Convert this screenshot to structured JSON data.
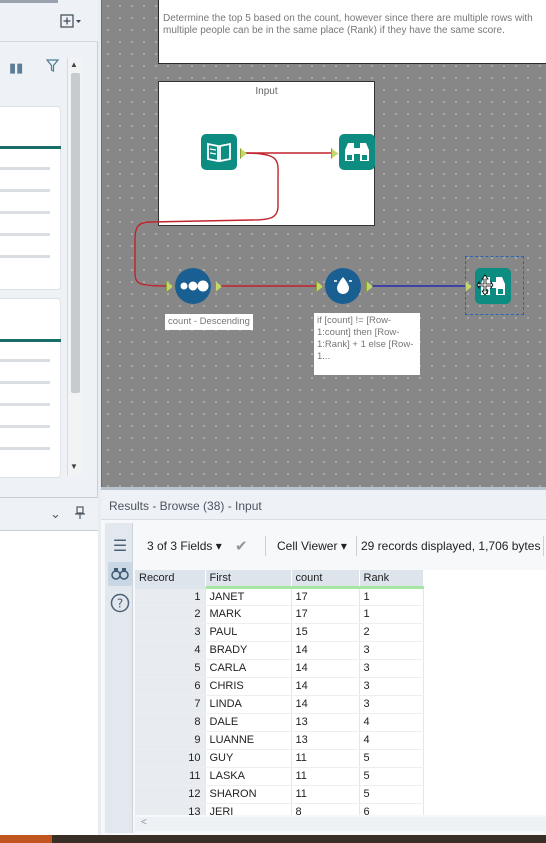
{
  "canvas": {
    "comment_text": "Determine the top 5 based on the count, however since there are multiple rows with multiple people can be in the same place (Rank) if they have the same score.",
    "container_title": "Input",
    "sort_label": "count - Descending",
    "formula_label": "if [count] != [Row-1:count] then [Row-1:Rank] + 1 else [Row-1..."
  },
  "results": {
    "title": "Results - Browse (38) - Input",
    "fields_selector": "3 of 3 Fields",
    "cell_viewer": "Cell Viewer",
    "records_info": "29 records displayed, 1,706 bytes",
    "columns": [
      "Record",
      "First",
      "count",
      "Rank"
    ],
    "rows": [
      [
        "1",
        "JANET",
        "17",
        "1"
      ],
      [
        "2",
        "MARK",
        "17",
        "1"
      ],
      [
        "3",
        "PAUL",
        "15",
        "2"
      ],
      [
        "4",
        "BRADY",
        "14",
        "3"
      ],
      [
        "5",
        "CARLA",
        "14",
        "3"
      ],
      [
        "6",
        "CHRIS",
        "14",
        "3"
      ],
      [
        "7",
        "LINDA",
        "14",
        "3"
      ],
      [
        "8",
        "DALE",
        "13",
        "4"
      ],
      [
        "9",
        "LUANNE",
        "13",
        "4"
      ],
      [
        "10",
        "GUY",
        "11",
        "5"
      ],
      [
        "11",
        "LASKA",
        "11",
        "5"
      ],
      [
        "12",
        "SHARON",
        "11",
        "5"
      ],
      [
        "13",
        "JERI",
        "8",
        "6"
      ]
    ]
  },
  "icons": {
    "field_list": "list-icon",
    "binoculars": "binoculars-icon",
    "help": "help-icon",
    "check": "check-icon",
    "pin": "pin-icon",
    "chevron": "chevron-down-icon"
  },
  "colors": {
    "input_tool": "#0d8d82",
    "browse_tool": "#0d8d82",
    "sort_tool": "#1a5f92",
    "formula_tool": "#1a5f92",
    "wire_red": "#c0242c",
    "wire_blue": "#2a2ab0"
  }
}
